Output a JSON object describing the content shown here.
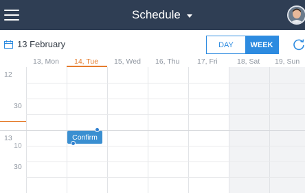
{
  "header": {
    "title": "Schedule",
    "menu_icon": "hamburger-menu-icon",
    "avatar_icon": "user-avatar-icon"
  },
  "datebar": {
    "current_date": "13 February",
    "calendar_icon": "calendar-icon",
    "view_day": "DAY",
    "view_week": "WEEK",
    "selected_view": "WEEK",
    "refresh_icon": "refresh-icon"
  },
  "days": [
    {
      "label": "13, Mon",
      "active": false
    },
    {
      "label": "14, Tue",
      "active": true
    },
    {
      "label": "15, Wed",
      "active": false
    },
    {
      "label": "16, Thu",
      "active": false
    },
    {
      "label": "17, Fri",
      "active": false
    },
    {
      "label": "18, Sat",
      "active": false
    },
    {
      "label": "19, Sun",
      "active": false
    }
  ],
  "times": {
    "t1": "12",
    "t2": "30",
    "t3": "13",
    "t4": "10",
    "t5": "30"
  },
  "event": {
    "label": "Confirm"
  },
  "colors": {
    "header_bg": "#2f3e54",
    "accent_blue": "#2d8be0",
    "today_orange": "#e57c2c",
    "event_blue": "#3a8fd1"
  }
}
